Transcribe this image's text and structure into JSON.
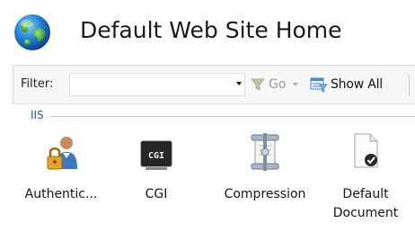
{
  "header": {
    "title": "Default Web Site Home",
    "icon": "globe-icon"
  },
  "toolbar": {
    "filter_label": "Filter:",
    "filter_value": "",
    "go_label": "Go",
    "go_icon": "funnel-icon",
    "show_all_label": "Show All",
    "show_all_icon": "show-all-icon"
  },
  "group": {
    "label": "IIS"
  },
  "features": [
    {
      "label": "Authentic...",
      "icon": "user-lock-icon"
    },
    {
      "label": "CGI",
      "icon": "cgi-icon"
    },
    {
      "label": "Compression",
      "icon": "compression-icon"
    },
    {
      "label": "Default\nDocument",
      "line1": "Default",
      "line2": "Document",
      "icon": "default-document-icon"
    }
  ],
  "colors": {
    "group_label": "#1f5fb4",
    "toolbar_bg": "#f7f7f7"
  }
}
